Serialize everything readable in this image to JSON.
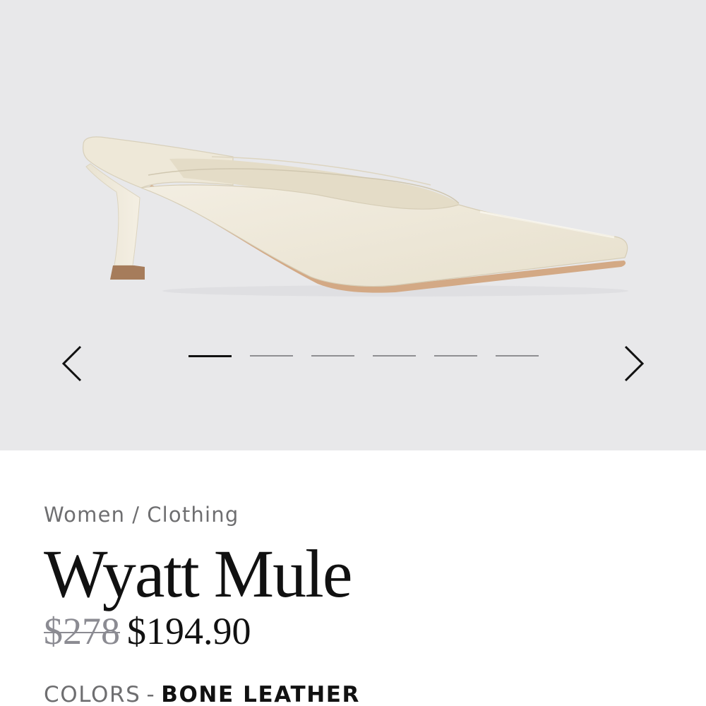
{
  "gallery": {
    "image_alt": "Wyatt Mule in bone leather, side view",
    "slide_count": 6,
    "active_index": 0,
    "prev_icon": "chevron-left-icon",
    "next_icon": "chevron-right-icon"
  },
  "product": {
    "breadcrumb": [
      "Women",
      "Clothing"
    ],
    "breadcrumb_separator": "/",
    "name": "Wyatt Mule",
    "price_original": "$278",
    "price_sale": "$194.90",
    "colors_label": "COLORS",
    "colors_separator": "-",
    "color_selected": "BONE LEATHER"
  },
  "colors": {
    "gallery_bg": "#e8e8ea",
    "text_primary": "#111111",
    "text_muted": "#6e6e70",
    "shoe_leather": "#efe9da",
    "heel_tip": "#a67c5b"
  }
}
